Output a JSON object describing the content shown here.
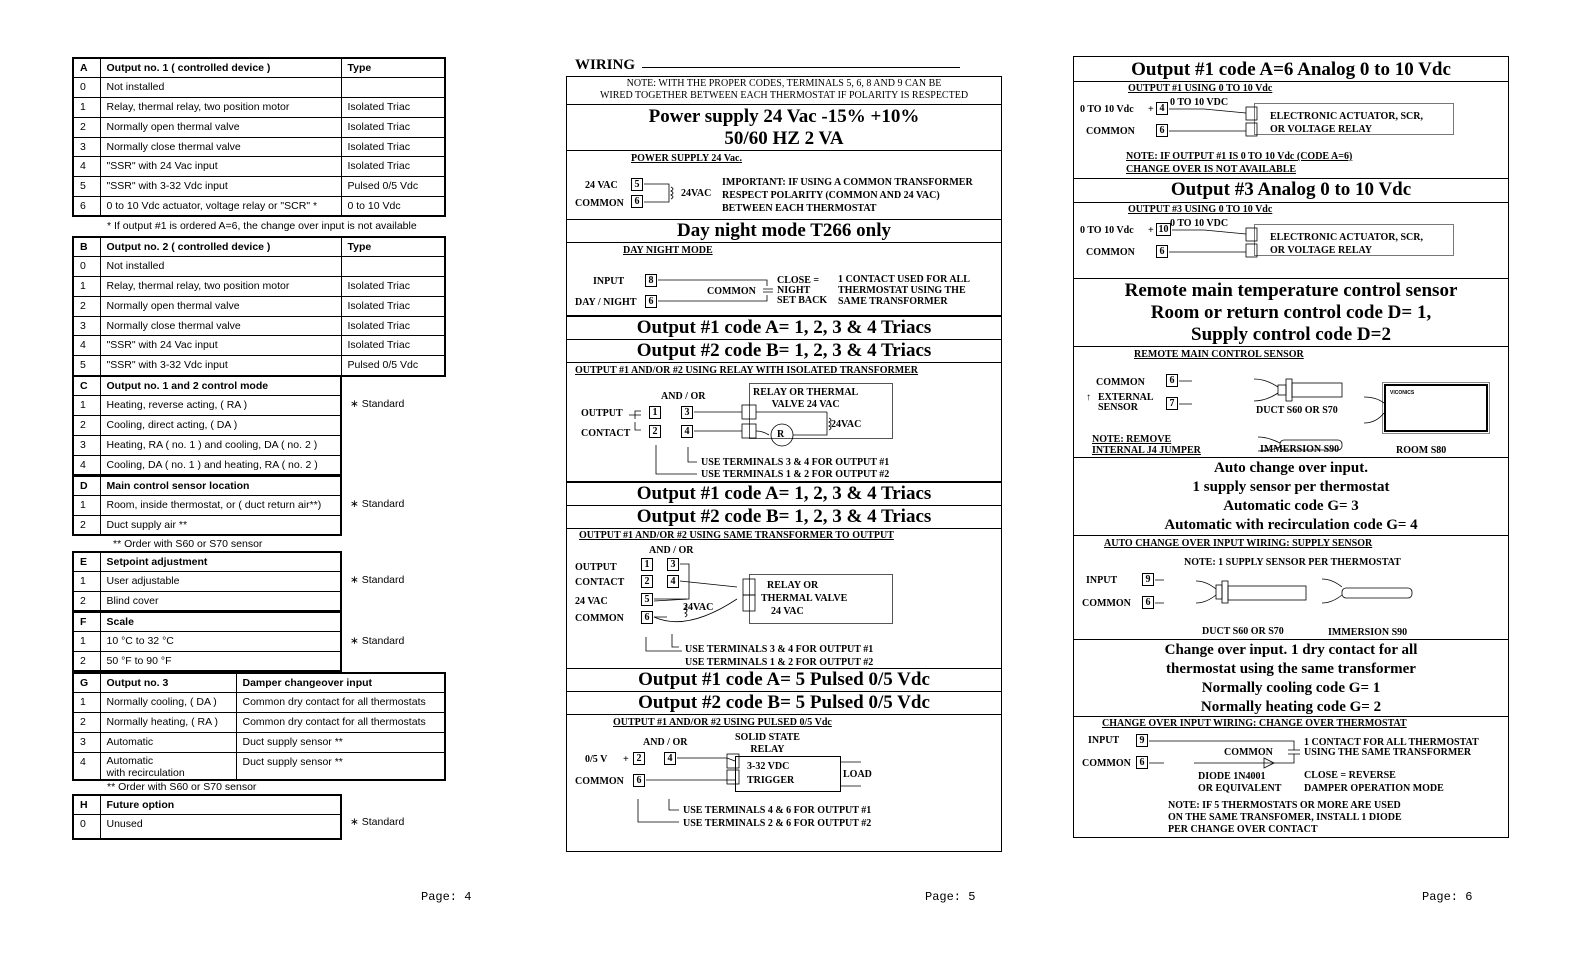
{
  "page4": {
    "tableA": {
      "code": "A",
      "title": "Output no. 1 ( controlled device )",
      "type_header": "Type",
      "rows": [
        {
          "code": "0",
          "desc": "Not installed",
          "type": ""
        },
        {
          "code": "1",
          "desc": "Relay, thermal relay, two position motor",
          "type": "Isolated  Triac"
        },
        {
          "code": "2",
          "desc": "Normally open thermal valve",
          "type": "Isolated  Triac"
        },
        {
          "code": "3",
          "desc": "Normally close thermal valve",
          "type": "Isolated  Triac"
        },
        {
          "code": "4",
          "desc": "\"SSR\" with 24 Vac input",
          "type": "Isolated  Triac"
        },
        {
          "code": "5",
          "desc": "\"SSR\" with 3-32 Vdc input",
          "type": "Pulsed 0/5 Vdc"
        },
        {
          "code": "6",
          "desc": "0 to 10 Vdc actuator, voltage relay or \"SCR\" *",
          "type": "0 to 10 Vdc"
        }
      ],
      "note": "* If output #1 is ordered A=6, the change over input is not available"
    },
    "tableB": {
      "code": "B",
      "title": "Output no. 2 ( controlled device )",
      "type_header": "Type",
      "rows": [
        {
          "code": "0",
          "desc": "Not installed",
          "type": ""
        },
        {
          "code": "1",
          "desc": "Relay, thermal relay, two position motor",
          "type": "Isolated  Triac"
        },
        {
          "code": "2",
          "desc": "Normally open thermal valve",
          "type": "Isolated  Triac"
        },
        {
          "code": "3",
          "desc": "Normally close thermal valve",
          "type": "Isolated  Triac"
        },
        {
          "code": "4",
          "desc": "\"SSR\" with 24 Vac input",
          "type": "Isolated  Triac"
        },
        {
          "code": "5",
          "desc": "\"SSR\" with 3-32 Vdc input",
          "type": "Pulsed 0/5 Vdc"
        }
      ]
    },
    "tableC": {
      "code": "C",
      "title": "Output no. 1 and 2 control mode",
      "rows": [
        {
          "code": "1",
          "desc": "Heating,  reverse acting,  ( RA )"
        },
        {
          "code": "2",
          "desc": "Cooling,  direct acting,    ( DA )"
        },
        {
          "code": "3",
          "desc": "Heating, RA ( no. 1 ) and cooling, DA ( no. 2 )"
        },
        {
          "code": "4",
          "desc": "Cooling, DA ( no. 1 ) and heating, RA ( no. 2 )"
        }
      ],
      "standard": "∗ Standard"
    },
    "tableD": {
      "code": "D",
      "title": "Main control sensor location",
      "rows": [
        {
          "code": "1",
          "desc": "Room, inside thermostat, or ( duct return air**)"
        },
        {
          "code": "2",
          "desc": "Duct supply air **"
        }
      ],
      "standard": "∗ Standard",
      "note": "**  Order with S60 or S70 sensor"
    },
    "tableE": {
      "code": "E",
      "title": "Setpoint adjustment",
      "rows": [
        {
          "code": "1",
          "desc": "User adjustable"
        },
        {
          "code": "2",
          "desc": "Blind cover"
        }
      ],
      "standard": "∗ Standard"
    },
    "tableF": {
      "code": "F",
      "title": "Scale",
      "rows": [
        {
          "code": "1",
          "desc": "10 °C to 32 °C"
        },
        {
          "code": "2",
          "desc": "50 °F to 90 °F"
        }
      ],
      "standard": "∗ Standard"
    },
    "tableG": {
      "code": "G",
      "title": "Output no. 3",
      "col2_header": "Damper changeover input",
      "rows": [
        {
          "code": "1",
          "desc": "Normally cooling,  ( DA )",
          "input": "Common dry contact for all thermostats"
        },
        {
          "code": "2",
          "desc": "Normally heating,  ( RA )",
          "input": "Common dry contact for all thermostats"
        },
        {
          "code": "3",
          "desc": "Automatic",
          "input": "Duct supply sensor  **"
        },
        {
          "code": "4",
          "desc": "Automatic",
          "desc2": "with recirculation",
          "input": "Duct supply sensor  **"
        }
      ],
      "note": "**  Order with S60 or S70 sensor"
    },
    "tableH": {
      "code": "H",
      "title": "Future option",
      "rows": [
        {
          "code": "0",
          "desc": "Unused"
        }
      ],
      "standard": "∗ Standard"
    },
    "page_label": "Page: 4"
  },
  "page5": {
    "heading": "WIRING",
    "note": [
      "NOTE: WITH THE PROPER CODES, TERMINALS 5, 6, 8 AND 9 CAN BE",
      "WIRED TOGETHER BETWEEN EACH THERMOSTAT IF POLARITY IS RESPECTED"
    ],
    "power_title": [
      "Power supply 24 Vac -15% +10%",
      "50/60 HZ 2 VA"
    ],
    "power": {
      "subtitle": "POWER SUPPLY 24 Vac.",
      "lbl_24vac": "24 VAC",
      "lbl_common": "COMMON",
      "t5": "5",
      "t6": "6",
      "src": "24VAC",
      "important": [
        "IMPORTANT: IF USING A COMMON TRANSFORMER",
        "RESPECT POLARITY (COMMON AND 24 VAC)",
        "BETWEEN EACH THERMOSTAT"
      ]
    },
    "daynight_title": "Day night mode T266 only",
    "daynight": {
      "subtitle": "DAY NIGHT MODE",
      "lbl_input": "INPUT",
      "lbl_dn": "DAY / NIGHT",
      "t8": "8",
      "t6": "6",
      "common": "COMMON",
      "close": [
        "CLOSE =",
        "NIGHT",
        "SET BACK"
      ],
      "contact": [
        "1 CONTACT USED FOR ALL",
        "THERMOSTAT USING THE",
        "SAME TRANSFORMER"
      ]
    },
    "triac1_title": "Output #1 code A= 1, 2, 3 & 4 Triacs",
    "triac2_title": "Output #2 code B= 1, 2, 3 & 4 Triacs",
    "relay_iso": {
      "subtitle": "OUTPUT #1 AND/OR #2 USING RELAY WITH ISOLATED TRANSFORMER",
      "andor": "AND / OR",
      "lbl_output": "OUTPUT",
      "lbl_contact": "CONTACT",
      "t1": "1",
      "t2": "2",
      "t3": "3",
      "t4": "4",
      "device": [
        "RELAY OR THERMAL",
        "VALVE 24 VAC"
      ],
      "src": "24VAC",
      "r": "R",
      "use": [
        "USE TERMINALS 3 & 4 FOR OUTPUT #1",
        "USE TERMINALS 1 & 2 FOR OUTPUT #2"
      ]
    },
    "triac1b_title": "Output #1 code A= 1, 2, 3 & 4 Triacs",
    "triac2b_title": "Output #2 code B= 1, 2, 3 & 4 Triacs",
    "relay_same": {
      "subtitle": "OUTPUT #1 AND/OR #2 USING SAME TRANSFORMER TO OUTPUT",
      "andor": "AND / OR",
      "lbl_output": "OUTPUT",
      "lbl_contact": "CONTACT",
      "lbl_24vac": "24 VAC",
      "lbl_common": "COMMON",
      "t1": "1",
      "t2": "2",
      "t3": "3",
      "t4": "4",
      "t5": "5",
      "t6": "6",
      "src": "24VAC",
      "device": [
        "RELAY OR",
        "THERMAL VALVE",
        "24 VAC"
      ],
      "use": [
        "USE TERMINALS 3 & 4 FOR OUTPUT #1",
        "USE TERMINALS 1 & 2 FOR OUTPUT #2"
      ]
    },
    "pulsed1_title": "Output #1 code A= 5 Pulsed 0/5 Vdc",
    "pulsed2_title": "Output #2 code B= 5 Pulsed 0/5 Vdc",
    "pulsed": {
      "subtitle": "OUTPUT #1 AND/OR #2 USING PULSED 0/5 Vdc",
      "andor": "AND / OR",
      "lbl_v": "0/5 V",
      "plus": "+",
      "lbl_common": "COMMON",
      "t2": "2",
      "t4": "4",
      "t6": "6",
      "ssr": [
        "SOLID STATE",
        "RELAY"
      ],
      "trigger": [
        "3-32 VDC",
        "TRIGGER"
      ],
      "load": "LOAD",
      "use": [
        "USE TERMINALS 4 & 6 FOR OUTPUT #1",
        "USE TERMINALS 2 & 6 FOR OUTPUT #2"
      ]
    },
    "page_label": "Page: 5"
  },
  "page6": {
    "analog1_title": "Output #1 code A=6 Analog 0 to 10 Vdc",
    "analog1": {
      "subtitle": "OUTPUT #1 USING 0 TO 10 Vdc ",
      "lbl_v": "0 TO 10 Vdc",
      "plus": "+",
      "lbl_common": "COMMON",
      "t_out": "4",
      "t6": "6",
      "wire": "0 TO 10 VDC",
      "device": [
        "ELECTRONIC ACTUATOR, SCR,",
        "OR VOLTAGE RELAY"
      ],
      "note": [
        "NOTE: IF OUTPUT #1 IS 0 TO 10 Vdc (CODE A=6)",
        "CHANGE OVER IS NOT AVAILABLE"
      ]
    },
    "analog3_title": "Output #3 Analog 0 to 10 Vdc",
    "analog3": {
      "subtitle": "OUTPUT #3 USING 0 TO 10 Vdc ",
      "lbl_v": "0 TO 10 Vdc",
      "plus": "+",
      "lbl_common": "COMMON",
      "t_out": "10",
      "t6": "6",
      "wire": "0 TO 10 VDC",
      "device": [
        "ELECTRONIC ACTUATOR, SCR,",
        "OR VOLTAGE RELAY"
      ]
    },
    "remote_title": [
      "Remote main temperature control sensor",
      "Room or return control code D= 1,",
      "Supply control code D=2"
    ],
    "remote": {
      "subtitle": "REMOTE MAIN CONTROL SENSOR",
      "lbl_common": "COMMON",
      "lbl_ext": [
        "EXTERNAL",
        "SENSOR"
      ],
      "t6": "6",
      "t7": "7",
      "duct": "DUCT S60 OR S70",
      "immersion": "IMMERSION S90",
      "room": "ROOM S80",
      "brand": "VICONICS",
      "note": [
        "NOTE: REMOVE",
        "INTERNAL J4 JUMPER"
      ]
    },
    "auto_title": [
      "Auto change over input.",
      "1 supply sensor per thermostat",
      "Automatic code G= 3",
      "Automatic with recirculation code G= 4"
    ],
    "auto": {
      "subtitle": "AUTO CHANGE OVER INPUT WIRING: SUPPLY SENSOR",
      "note": "NOTE: 1 SUPPLY SENSOR PER THERMOSTAT",
      "lbl_input": "INPUT",
      "lbl_common": "COMMON",
      "t9": "9",
      "t6": "6",
      "duct": "DUCT S60 OR S70",
      "immersion": "IMMERSION S90"
    },
    "changeover_title": [
      "Change over input. 1 dry contact for all",
      "thermostat using the same transformer",
      "Normally cooling code G= 1",
      "Normally heating code G= 2"
    ],
    "changeover": {
      "subtitle": "CHANGE OVER INPUT WIRING: CHANGE OVER THERMOSTAT",
      "lbl_input": "INPUT",
      "lbl_common": "COMMON",
      "t9": "9",
      "t6": "6",
      "common2": "COMMON",
      "contact": [
        "1 CONTACT FOR ALL THERMOSTAT",
        "USING THE SAME TRANSFORMER"
      ],
      "diode": [
        "DIODE 1N4001",
        "OR EQUIVALENT"
      ],
      "close": [
        "CLOSE = REVERSE",
        "DAMPER OPERATION MODE"
      ],
      "note": [
        "NOTE: IF 5 THERMOSTATS OR MORE ARE USED",
        "ON THE SAME TRANSFOMER, INSTALL 1 DIODE",
        "PER CHANGE OVER CONTACT"
      ]
    },
    "page_label": "Page: 6"
  }
}
